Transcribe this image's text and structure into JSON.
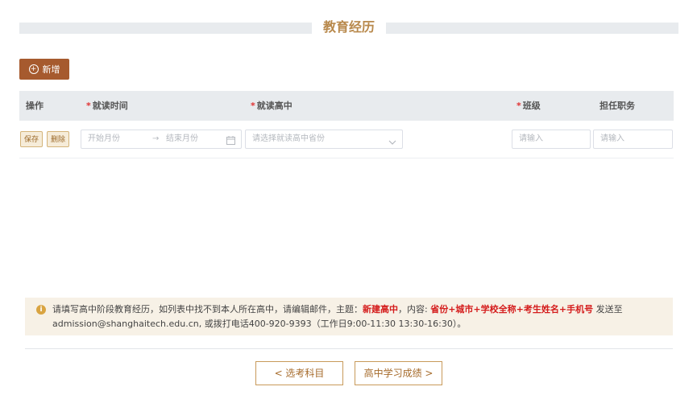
{
  "section": {
    "title": "教育经历"
  },
  "toolbar": {
    "add_label": "新增",
    "add_icon": "plus-circle-icon"
  },
  "table": {
    "headers": {
      "action": "操作",
      "period": "就读时间",
      "school": "就读高中",
      "class": "班级",
      "position": "担任职务"
    },
    "required_mark": "*",
    "row": {
      "save_label": "保存",
      "delete_label": "删除",
      "start_placeholder": "开始月份",
      "range_sep": "→",
      "end_placeholder": "结束月份",
      "school_placeholder": "请选择就读高中省份",
      "class_placeholder": "请输入",
      "position_placeholder": "请输入"
    }
  },
  "notice": {
    "icon": "info-icon",
    "text_1": "请填写高中阶段教育经历，如列表中找不到本人所在高中，请编辑邮件，主题：",
    "subject": "新建高中",
    "text_2": "，内容: ",
    "content": "省份+城市+学校全称+考生姓名+手机号",
    "text_3": " 发送至",
    "line_2": "admission@shanghaitech.edu.cn, 或拨打电话400-920-9393（工作日9:00-11:30 13:30-16:30）。"
  },
  "nav": {
    "prev_label": "< 选考科目",
    "next_label": "高中学习成绩 >"
  },
  "colors": {
    "accent": "#a65a2e",
    "title": "#b8894c",
    "notice_bg": "#f7f1e6",
    "required": "#e03131"
  }
}
